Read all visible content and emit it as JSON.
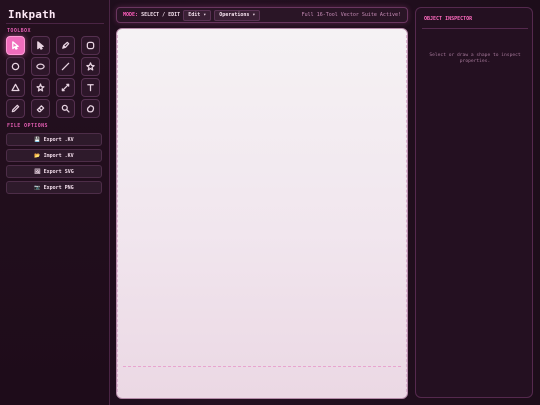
{
  "app": {
    "title": "Inkpath"
  },
  "sidebar": {
    "tools_label": "TOOLBOX",
    "tools": [
      {
        "icon": "select-arrow-icon",
        "active": true
      },
      {
        "icon": "direct-select-icon",
        "active": false
      },
      {
        "icon": "pen-tool-icon",
        "active": false
      },
      {
        "icon": "rounded-rect-icon",
        "active": false
      },
      {
        "icon": "circle-icon",
        "active": false
      },
      {
        "icon": "ellipse-icon",
        "active": false
      },
      {
        "icon": "line-icon",
        "active": false
      },
      {
        "icon": "star-icon",
        "active": false
      },
      {
        "icon": "triangle-icon",
        "active": false
      },
      {
        "icon": "star-outline-icon",
        "active": false
      },
      {
        "icon": "measure-icon",
        "active": false
      },
      {
        "icon": "text-icon",
        "active": false
      },
      {
        "icon": "pencil-icon",
        "active": false
      },
      {
        "icon": "eraser-icon",
        "active": false
      },
      {
        "icon": "zoom-icon",
        "active": false
      },
      {
        "icon": "hand-icon",
        "active": false
      }
    ],
    "file_label": "FILE OPTIONS",
    "file_buttons": [
      {
        "icon": "💾",
        "label": "Export .KV"
      },
      {
        "icon": "📂",
        "label": "Import .KV"
      },
      {
        "icon": "🖼",
        "label": "Export SVG"
      },
      {
        "icon": "📷",
        "label": "Export PNG"
      }
    ]
  },
  "toolbar": {
    "mode_label": "MODE:",
    "mode_value": "SELECT / EDIT",
    "edit_menu": "Edit ▾",
    "operations_menu": "Operations ▾",
    "status": "Full 16-Tool Vector Suite Active!"
  },
  "inspector": {
    "title": "OBJECT INSPECTOR",
    "hint": "Select or draw a shape to inspect properties."
  },
  "colors": {
    "accent": "#f06dbd",
    "label_pink": "#e25db2",
    "panel_bg": "#241021"
  }
}
